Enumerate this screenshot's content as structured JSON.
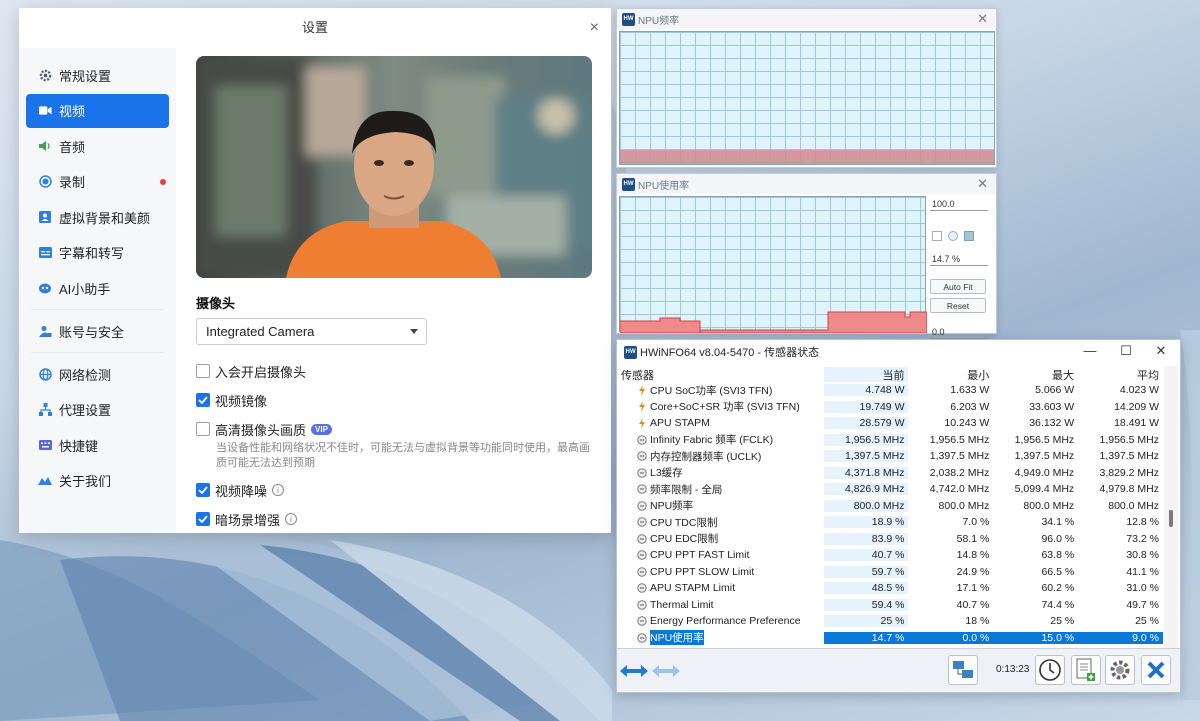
{
  "settings": {
    "title": "设置",
    "close_glyph": "×",
    "sidebar": [
      {
        "label": "常规设置",
        "icon": "gear-icon"
      },
      {
        "label": "视频",
        "icon": "video-camera-icon",
        "active": true
      },
      {
        "label": "音频",
        "icon": "speaker-icon"
      },
      {
        "label": "录制",
        "icon": "record-icon",
        "dot": true
      },
      {
        "label": "虚拟背景和美颜",
        "icon": "portrait-icon"
      },
      {
        "label": "字幕和转写",
        "icon": "caption-icon"
      },
      {
        "label": "AI小助手",
        "icon": "robot-icon"
      },
      {
        "label": "账号与安全",
        "icon": "account-lock-icon"
      },
      {
        "label": "网络检测",
        "icon": "globe-icon"
      },
      {
        "label": "代理设置",
        "icon": "proxy-icon"
      },
      {
        "label": "快捷键",
        "icon": "keyboard-icon"
      },
      {
        "label": "关于我们",
        "icon": "about-logo-icon"
      }
    ],
    "camera_section_title": "摄像头",
    "camera_select_value": "Integrated Camera",
    "options": [
      {
        "label": "入会开启摄像头",
        "checked": false
      },
      {
        "label": "视频镜像",
        "checked": true
      },
      {
        "label": "高清摄像头画质",
        "checked": false,
        "badge": "VIP"
      },
      {
        "label": "视频降噪",
        "checked": true,
        "info": true
      },
      {
        "label": "暗场景增强",
        "checked": true,
        "info": true
      }
    ],
    "hd_hint": "当设备性能和网络状况不佳时，可能无法与虚拟背景等功能同时使用，最高画质可能无法达到预期",
    "info_glyph": "i"
  },
  "npu_freq_window": {
    "title": "NPU频率",
    "close_glyph": "✕"
  },
  "npu_usage_window": {
    "title": "NPU使用率",
    "close_glyph": "✕",
    "max_value": "100.0",
    "current_value": "14.7 %",
    "min_value": "0.0",
    "autofit_label": "Auto Fit",
    "reset_label": "Reset"
  },
  "sensor_window": {
    "title": "HWiNFO64 v8.04-5470 - 传感器状态",
    "min_glyph": "—",
    "max_glyph": "☐",
    "close_glyph": "✕",
    "columns": [
      "传感器",
      "当前",
      "最小",
      "最大",
      "平均"
    ],
    "rows": [
      {
        "name": "CPU SoC功率 (SVI3 TFN)",
        "icon": "power-bolt-icon",
        "cur": "4.748 W",
        "min": "1.633 W",
        "max": "5.066 W",
        "avg": "4.023 W"
      },
      {
        "name": "Core+SoC+SR 功率 (SVI3 TFN)",
        "icon": "power-bolt-icon",
        "cur": "19.749 W",
        "min": "6.203 W",
        "max": "33.603 W",
        "avg": "14.209 W"
      },
      {
        "name": "APU STAPM",
        "icon": "power-bolt-icon",
        "cur": "28.579 W",
        "min": "10.243 W",
        "max": "36.132 W",
        "avg": "18.491 W"
      },
      {
        "name": "Infinity Fabric 频率 (FCLK)",
        "icon": "clock-sensor-icon",
        "cur": "1,956.5 MHz",
        "min": "1,956.5 MHz",
        "max": "1,956.5 MHz",
        "avg": "1,956.5 MHz"
      },
      {
        "name": "内存控制器频率 (UCLK)",
        "icon": "clock-sensor-icon",
        "cur": "1,397.5 MHz",
        "min": "1,397.5 MHz",
        "max": "1,397.5 MHz",
        "avg": "1,397.5 MHz"
      },
      {
        "name": "L3缓存",
        "icon": "clock-sensor-icon",
        "cur": "4,371.8 MHz",
        "min": "2,038.2 MHz",
        "max": "4,949.0 MHz",
        "avg": "3,829.2 MHz"
      },
      {
        "name": "频率限制 - 全局",
        "icon": "clock-sensor-icon",
        "cur": "4,826.9 MHz",
        "min": "4,742.0 MHz",
        "max": "5,099.4 MHz",
        "avg": "4,979.8 MHz"
      },
      {
        "name": "NPU频率",
        "icon": "clock-sensor-icon",
        "cur": "800.0 MHz",
        "min": "800.0 MHz",
        "max": "800.0 MHz",
        "avg": "800.0 MHz"
      },
      {
        "name": "CPU TDC限制",
        "icon": "clock-sensor-icon",
        "cur": "18.9 %",
        "min": "7.0 %",
        "max": "34.1 %",
        "avg": "12.8 %"
      },
      {
        "name": "CPU EDC限制",
        "icon": "clock-sensor-icon",
        "cur": "83.9 %",
        "min": "58.1 %",
        "max": "96.0 %",
        "avg": "73.2 %"
      },
      {
        "name": "CPU PPT FAST Limit",
        "icon": "clock-sensor-icon",
        "cur": "40.7 %",
        "min": "14.8 %",
        "max": "63.8 %",
        "avg": "30.8 %"
      },
      {
        "name": "CPU PPT SLOW Limit",
        "icon": "clock-sensor-icon",
        "cur": "59.7 %",
        "min": "24.9 %",
        "max": "66.5 %",
        "avg": "41.1 %"
      },
      {
        "name": "APU STAPM Limit",
        "icon": "clock-sensor-icon",
        "cur": "48.5 %",
        "min": "17.1 %",
        "max": "60.2 %",
        "avg": "31.0 %"
      },
      {
        "name": "Thermal Limit",
        "icon": "clock-sensor-icon",
        "cur": "59.4 %",
        "min": "40.7 %",
        "max": "74.4 %",
        "avg": "49.7 %"
      },
      {
        "name": "Energy Performance Preference",
        "icon": "clock-sensor-icon",
        "cur": "25 %",
        "min": "18 %",
        "max": "25 %",
        "avg": "25 %"
      },
      {
        "name": "NPU使用率",
        "icon": "clock-sensor-icon",
        "cur": "14.7 %",
        "min": "0.0 %",
        "max": "15.0 %",
        "avg": "9.0 %",
        "selected": true
      }
    ],
    "elapsed": "0:13:23"
  },
  "colors": {
    "accent": "#1a73e8",
    "graph_bg": "#dff3fb",
    "graph_fill": "#f08a8a",
    "selected_row": "#0a78d8"
  }
}
